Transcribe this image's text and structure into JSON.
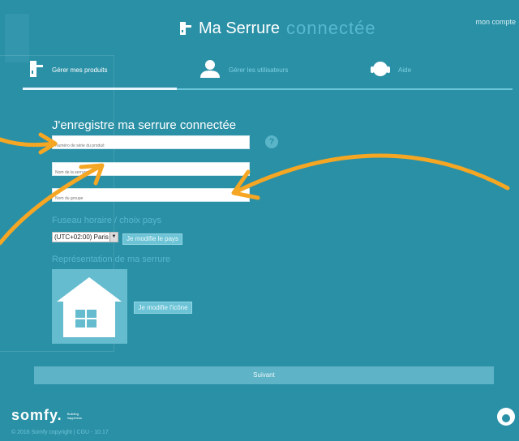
{
  "header": {
    "title_main": "Ma Serrure",
    "title_accent": "connectée",
    "account_link": "mon compte"
  },
  "nav": {
    "items": [
      {
        "label": "Gérer mes produits",
        "icon": "door-lock-icon",
        "active": true
      },
      {
        "label": "Gérer les utilisateurs",
        "icon": "user-icon",
        "active": false
      },
      {
        "label": "Aide",
        "icon": "headset-icon",
        "active": false
      }
    ]
  },
  "form": {
    "title": "J'enregistre ma serrure connectée",
    "serial_placeholder": "Numéro de série du produit",
    "name_placeholder": "Nom de la serrure",
    "group_placeholder": "Nom du groupe",
    "help_glyph": "?",
    "timezone_label": "Fuseau horaire / choix pays",
    "timezone_value": "(UTC+02:00) Paris",
    "change_country_label": "Je modifie le pays",
    "icon_label": "Représentation de ma serrure",
    "change_icon_label": "Je modifie l'icône",
    "submit_label": "Suivant"
  },
  "footer": {
    "logo_text": "somfy.",
    "logo_tagline_line1": "Building",
    "logo_tagline_line2": "happiness",
    "copyright": "© 2016 Somfy copyright | CGU - 10.17"
  },
  "colors": {
    "background": "#2a90a6",
    "accent": "#56b9cf",
    "annotation_arrow": "#f5a623"
  }
}
